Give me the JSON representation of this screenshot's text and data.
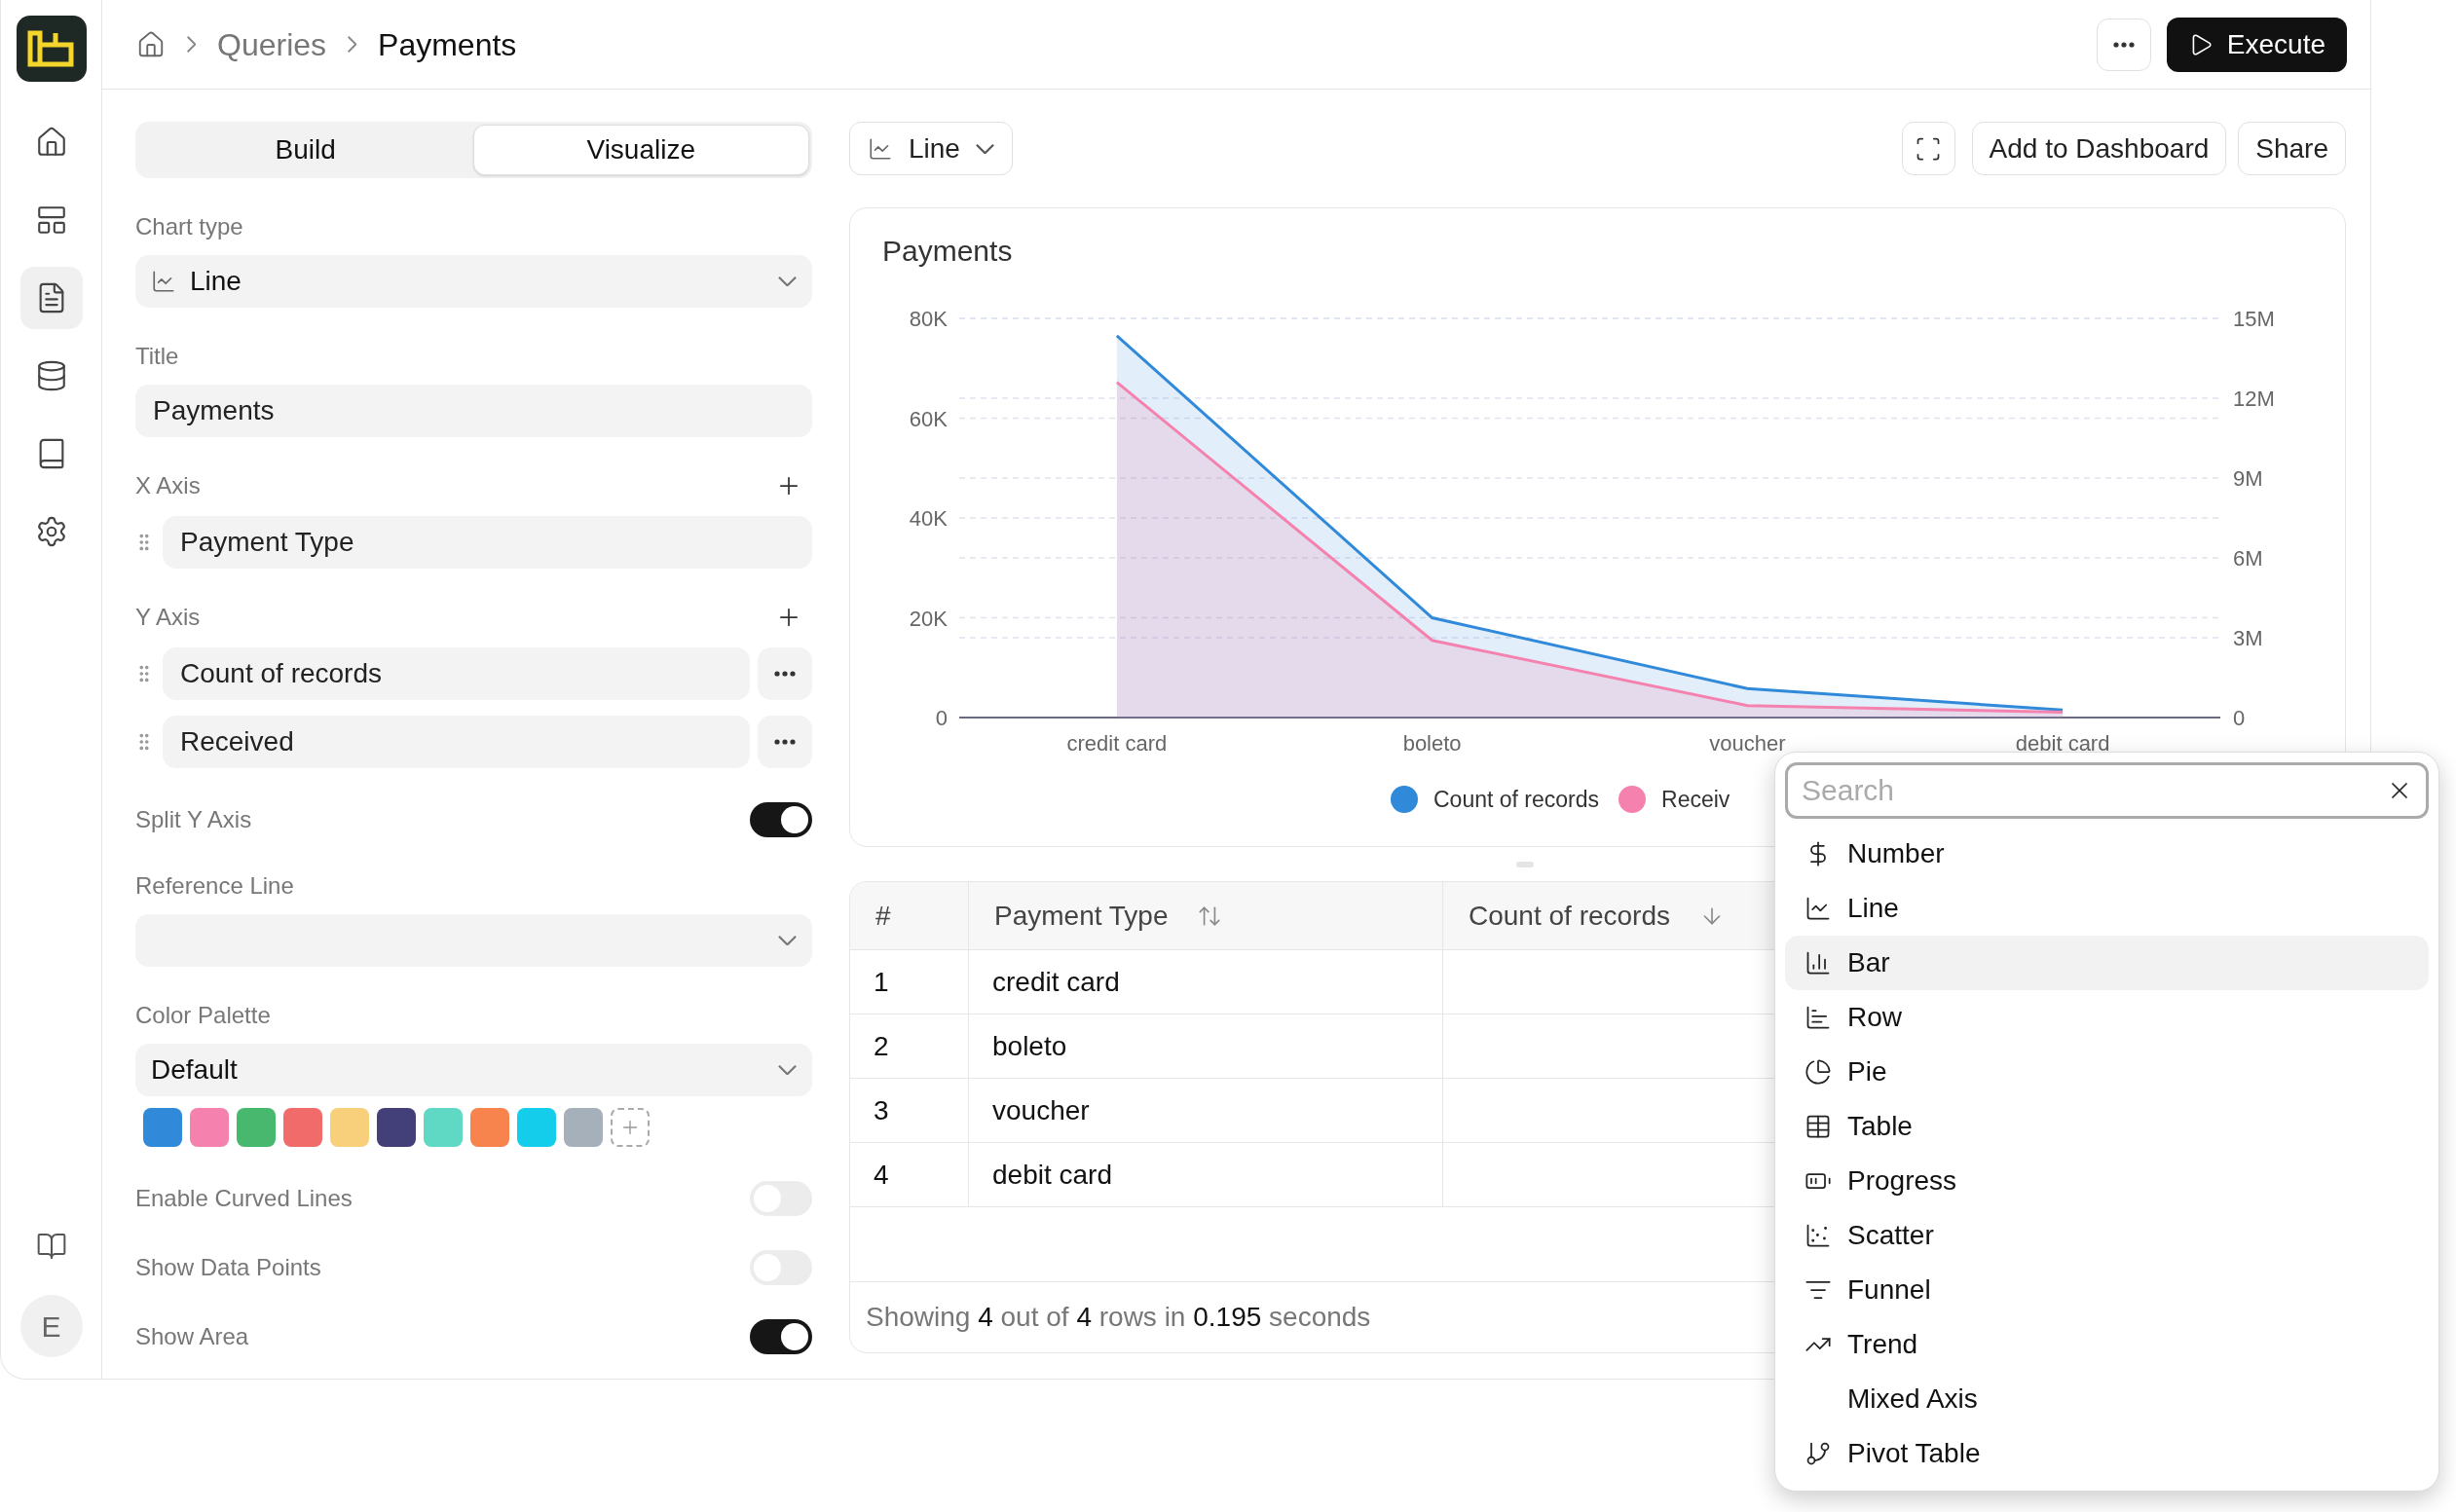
{
  "sidebar": {
    "nav": [
      {
        "selected": false
      },
      {
        "selected": false
      },
      {
        "selected": true
      },
      {
        "selected": false
      },
      {
        "selected": false
      },
      {
        "selected": false
      }
    ],
    "avatar": "E"
  },
  "breadcrumb": [
    "Queries",
    "Payments"
  ],
  "execute": "Execute",
  "tabs": [
    {
      "label": "Build",
      "selected": false
    },
    {
      "label": "Visualize",
      "selected": true
    }
  ],
  "settings": [
    {
      "kind": "chart-select",
      "label": "Chart type",
      "value": "Line"
    },
    {
      "kind": "text",
      "label": "Title",
      "value": "Payments"
    },
    {
      "kind": "fields",
      "label": "X Axis",
      "items": [
        {
          "label": "Payment Type",
          "menu": false
        }
      ]
    },
    {
      "kind": "fields",
      "label": "Y Axis",
      "items": [
        {
          "label": "Count of records",
          "menu": true
        },
        {
          "label": "Received",
          "menu": true
        }
      ]
    },
    {
      "kind": "toggle",
      "label": "Split Y Axis",
      "on": true
    },
    {
      "kind": "select",
      "label": "Reference Line"
    },
    {
      "kind": "palette",
      "label": "Color Palette",
      "value": "Default",
      "swatches": [
        {
          "color": "#318ad9"
        },
        {
          "color": "#f582ae"
        },
        {
          "color": "#48b86f"
        },
        {
          "color": "#f26b6b"
        },
        {
          "color": "#f8cf7a"
        },
        {
          "color": "#423f79"
        },
        {
          "color": "#5fd9c4"
        },
        {
          "color": "#f7834d"
        },
        {
          "color": "#13cdeb"
        },
        {
          "color": "#a6b0ba"
        }
      ]
    },
    {
      "kind": "toggle",
      "label": "Enable Curved Lines",
      "on": false
    },
    {
      "kind": "toggle",
      "label": "Show Data Points",
      "on": false
    },
    {
      "kind": "toggle",
      "label": "Show Area",
      "on": true
    }
  ],
  "toolbar": {
    "chart_type": "Line",
    "buttons": [
      "Add to Dashboard",
      "Share"
    ]
  },
  "chart": {
    "title": "Payments",
    "chart_data": {
      "type": "area",
      "categories": [
        "credit card",
        "boleto",
        "voucher",
        "debit card"
      ],
      "grid": true,
      "series": [
        {
          "name": "Count of records",
          "color": "#318ad9",
          "values": [
            76500,
            20000,
            5800,
            1500
          ]
        },
        {
          "name": "Receiv",
          "color": "#f582ae",
          "axis": "y2",
          "values": [
            12600000,
            2900000,
            450000,
            200000
          ]
        }
      ],
      "ylim": [
        0,
        80000
      ],
      "yticks": [
        {
          "value": 0,
          "label": "0"
        },
        {
          "value": 20000,
          "label": "20K"
        },
        {
          "value": 40000,
          "label": "40K"
        },
        {
          "value": 60000,
          "label": "60K"
        },
        {
          "value": 80000,
          "label": "80K"
        }
      ],
      "y2lim": [
        0,
        15000000
      ],
      "y2ticks": [
        {
          "value": 0,
          "label": "0"
        },
        {
          "value": 3000000,
          "label": "3M"
        },
        {
          "value": 6000000,
          "label": "6M"
        },
        {
          "value": 9000000,
          "label": "9M"
        },
        {
          "value": 12000000,
          "label": "12M"
        },
        {
          "value": 15000000,
          "label": "15M"
        }
      ]
    }
  },
  "table": {
    "columns": [
      {
        "label": "#"
      },
      {
        "label": "Payment Type",
        "sorted": false
      },
      {
        "label": "Count of records",
        "sorted": true
      }
    ],
    "rows": [
      [
        "1",
        "credit card"
      ],
      [
        "2",
        "boleto"
      ],
      [
        "3",
        "voucher"
      ],
      [
        "4",
        "debit card"
      ]
    ],
    "footer": "Showing **4** out of **4** rows in **0.195** seconds"
  },
  "dropdown": {
    "placeholder": "Search",
    "items": [
      {
        "label": "Number",
        "selected": false
      },
      {
        "label": "Line",
        "selected": false
      },
      {
        "label": "Bar",
        "selected": true
      },
      {
        "label": "Row",
        "selected": false
      },
      {
        "label": "Pie",
        "selected": false
      },
      {
        "label": "Table",
        "selected": false
      },
      {
        "label": "Progress",
        "selected": false
      },
      {
        "label": "Scatter",
        "selected": false
      },
      {
        "label": "Funnel",
        "selected": false
      },
      {
        "label": "Trend",
        "selected": false
      },
      {
        "label": "Mixed Axis",
        "selected": false
      },
      {
        "label": "Pivot Table",
        "selected": false
      }
    ]
  }
}
